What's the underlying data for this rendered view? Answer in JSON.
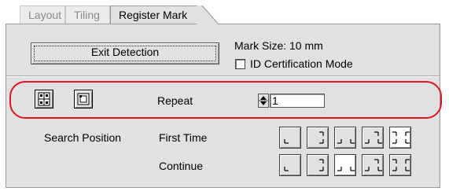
{
  "tabs": [
    {
      "label": "Layout",
      "active": false
    },
    {
      "label": "Tiling",
      "active": false
    },
    {
      "label": "Register Mark",
      "active": true
    }
  ],
  "exit_button": {
    "label": "Exit Detection"
  },
  "mark_size": {
    "label": "Mark Size:",
    "value": "10 mm"
  },
  "id_certification": {
    "label": "ID Certification Mode",
    "checked": false
  },
  "icon_buttons": [
    {
      "name": "register-mark-grid-icon"
    },
    {
      "name": "register-mark-corner-icon"
    }
  ],
  "repeat": {
    "label": "Repeat",
    "value": "1"
  },
  "search_position": {
    "label": "Search Position",
    "rows": [
      {
        "label": "First Time",
        "selected_index": 4
      },
      {
        "label": "Continue",
        "selected_index": 2
      }
    ]
  },
  "colors": {
    "highlight": "#e0141e",
    "panel": "#e1e1e1"
  }
}
